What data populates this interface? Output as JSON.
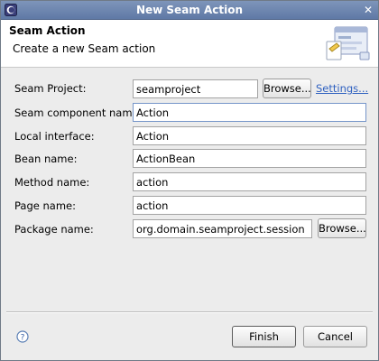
{
  "window": {
    "title": "New Seam Action"
  },
  "header": {
    "title": "Seam Action",
    "description": "Create a new Seam action"
  },
  "form": {
    "seam_project": {
      "label": "Seam Project:",
      "value": "seamproject",
      "browse": "Browse...",
      "settings": "Settings..."
    },
    "component_name": {
      "label": "Seam component name:",
      "value": "Action"
    },
    "local_interface": {
      "label": "Local interface:",
      "value": "Action"
    },
    "bean_name": {
      "label": "Bean name:",
      "value": "ActionBean"
    },
    "method_name": {
      "label": "Method name:",
      "value": "action"
    },
    "page_name": {
      "label": "Page name:",
      "value": "action"
    },
    "package_name": {
      "label": "Package name:",
      "value": "org.domain.seamproject.session",
      "browse": "Browse..."
    }
  },
  "footer": {
    "finish": "Finish",
    "cancel": "Cancel"
  },
  "icons": {
    "app": "eclipse-icon",
    "close": "close-icon",
    "banner": "wizard-banner-icon",
    "help": "help-icon"
  }
}
